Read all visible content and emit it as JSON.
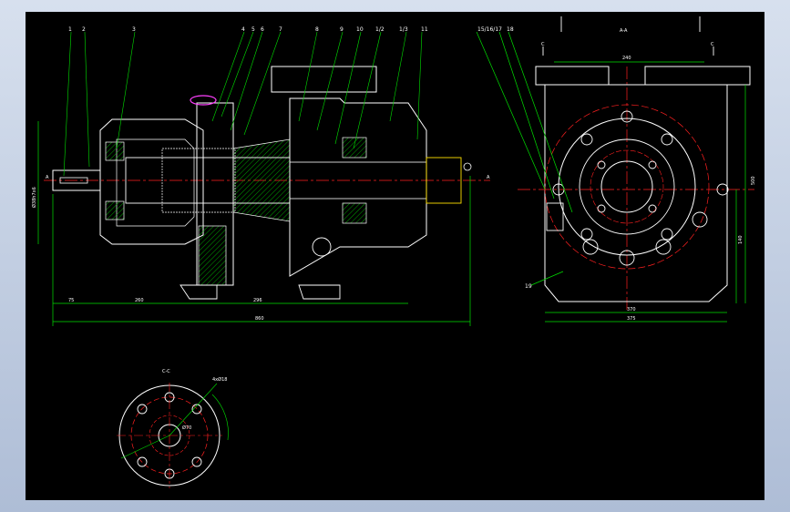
{
  "drawing": {
    "colors": {
      "background": "#000000",
      "frame": "#b8c6dc",
      "outline": "#ffffff",
      "centerline": "#ff2020",
      "dimension": "#00e000",
      "hatch": "#00c800",
      "hidden": "#ffe000",
      "highlight": "#ff40ff"
    },
    "part_numbers": [
      "1",
      "2",
      "3",
      "4",
      "5",
      "6",
      "7",
      "8",
      "9",
      "10",
      "1/2",
      "1/3",
      "11",
      "15/16/17",
      "18",
      "19"
    ],
    "section_marks": [
      "A",
      "A",
      "C",
      "C",
      "C-C",
      "A-A"
    ],
    "dimensions": {
      "main_length": "860",
      "left_span": "75",
      "mid_span_1": "260",
      "mid_span_2": "296",
      "shaft_dia": "Ø38h7x6",
      "side_width": "240",
      "base_width_1": "370",
      "base_width_2": "375",
      "height_1": "140",
      "height_2": "500",
      "flange_1": "4xØ18",
      "flange_2": "Ø70"
    }
  }
}
